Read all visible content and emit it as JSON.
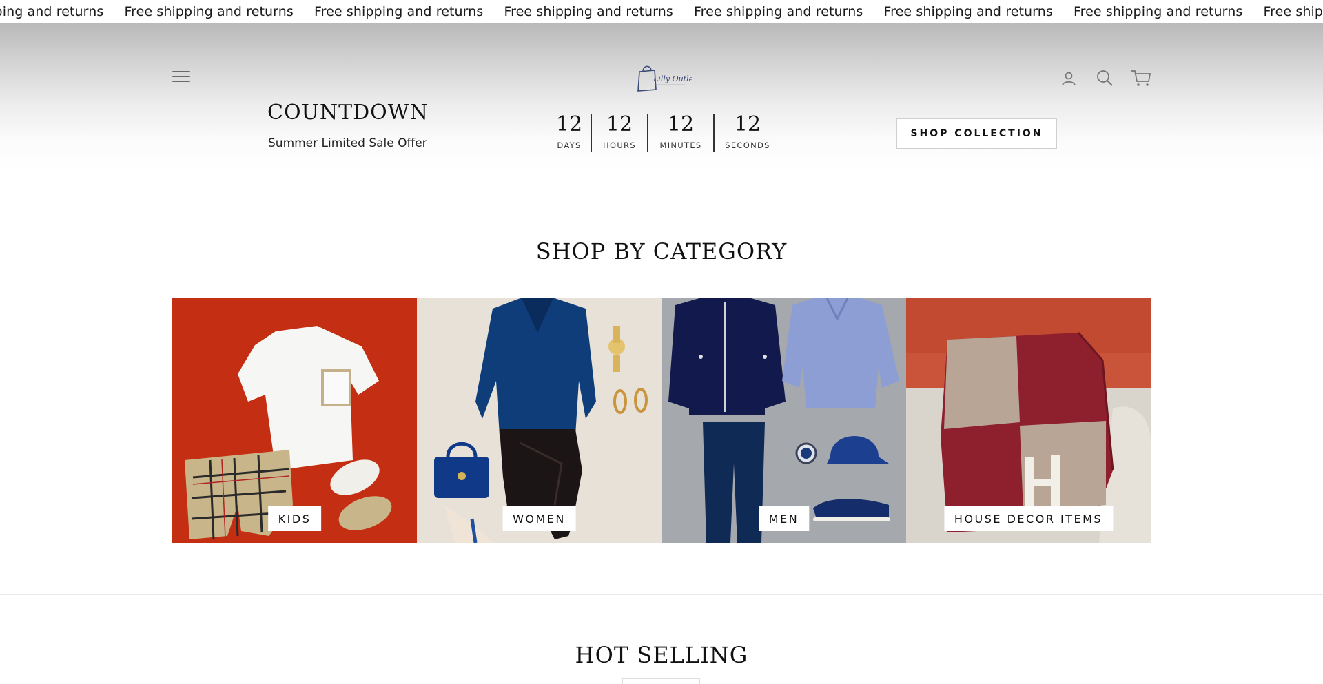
{
  "announcement": {
    "items": [
      "Free shipping and returns",
      "Free shipping and returns",
      "Free shipping and returns",
      "Free shipping and returns",
      "Free shipping and returns",
      "Free shipping and returns",
      "Free shipping and returns",
      "Free shipping and returns"
    ]
  },
  "header": {
    "logo_text": "Lilly Outlets",
    "menu_icon": "hamburger-menu-icon",
    "account_icon": "user-icon",
    "search_icon": "search-icon",
    "cart_icon": "cart-icon"
  },
  "countdown": {
    "title": "COUNTDOWN",
    "subtitle": "Summer Limited Sale Offer",
    "units": [
      {
        "value": "12",
        "label": "DAYS"
      },
      {
        "value": "12",
        "label": "HOURS"
      },
      {
        "value": "12",
        "label": "MINUTES"
      },
      {
        "value": "12",
        "label": "SECONDS"
      }
    ],
    "cta_label": "SHOP COLLECTION"
  },
  "categories": {
    "title": "SHOP BY CATEGORY",
    "items": [
      {
        "label": "KIDS",
        "bg": "#c42e12"
      },
      {
        "label": "WOMEN",
        "bg": "#e8e1d8"
      },
      {
        "label": "MEN",
        "bg": "#a5a8ad"
      },
      {
        "label": "HOUSE DECOR ITEMS",
        "bg": "#c9543a"
      }
    ]
  },
  "hot_selling": {
    "title": "HOT SELLING"
  }
}
